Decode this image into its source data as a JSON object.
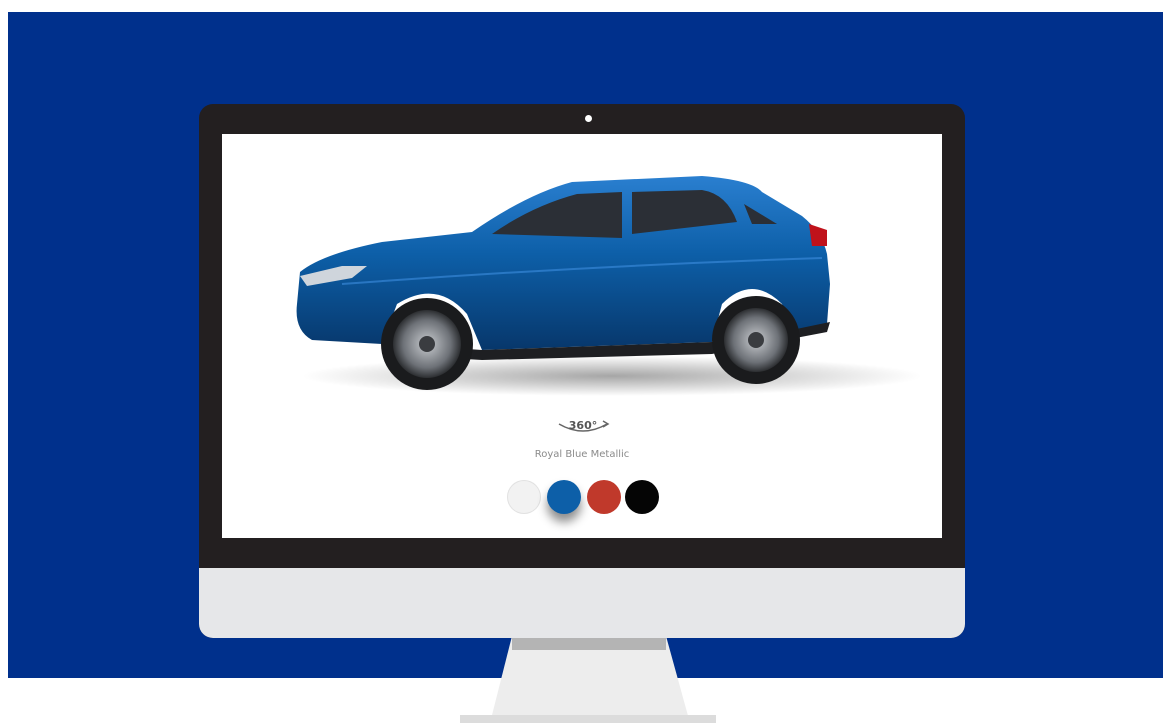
{
  "configurator": {
    "rotate_label": "360°",
    "selected_color_name": "Royal Blue Metallic",
    "colors": [
      {
        "id": "white",
        "hex": "#f2f2f2",
        "selected": false
      },
      {
        "id": "blue",
        "hex": "#0d5fa8",
        "selected": true
      },
      {
        "id": "red",
        "hex": "#c0392b",
        "selected": false
      },
      {
        "id": "black",
        "hex": "#050505",
        "selected": false
      }
    ]
  },
  "theme": {
    "backdrop": "#00308c",
    "bezel": "#231f20",
    "chin": "#e6e7e9",
    "stand": "#ececec"
  }
}
